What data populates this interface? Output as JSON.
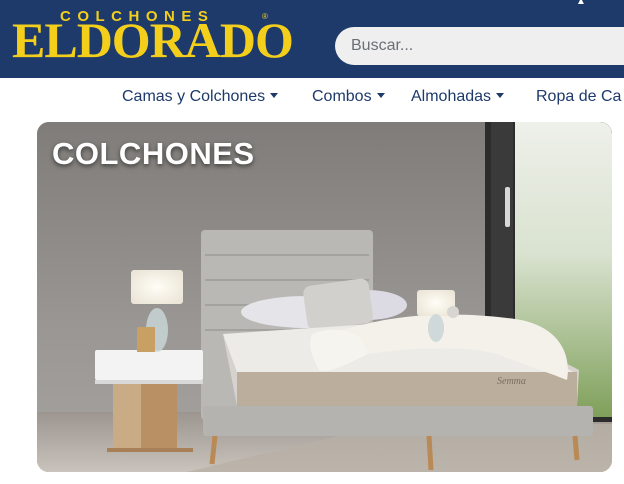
{
  "brand": {
    "top_word": "COLCHONES",
    "main_word": "ELDORADO",
    "registered": "®"
  },
  "search": {
    "placeholder": "Buscar..."
  },
  "nav": {
    "items": [
      {
        "label": "Camas y Colchones"
      },
      {
        "label": "Combos"
      },
      {
        "label": "Almohadas"
      },
      {
        "label": "Ropa de Ca"
      }
    ]
  },
  "banner": {
    "title": "COLCHONES",
    "mattress_label": "Semma"
  },
  "colors": {
    "header_bg": "#1e3a6b",
    "logo_yellow": "#f3cf1c",
    "nav_text": "#1e3a6b"
  },
  "icons": {
    "nav_dropdown": "caret-down-icon",
    "top_caret": "caret-up-icon"
  }
}
